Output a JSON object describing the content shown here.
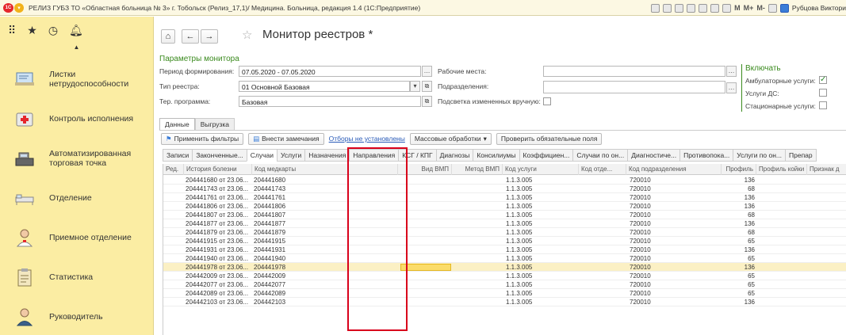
{
  "window": {
    "title": "РЕЛИЗ ГУБЗ ТО «Областная больница № 3» г. Тобольск (Релиз_17,1)/ Медицина. Больница, редакция 1.4  (1С:Предприятие)",
    "logo_text": "1С",
    "toolbar_text": [
      "M",
      "M+",
      "M-"
    ],
    "user": "Рубцова Виктори"
  },
  "sidebar": {
    "items": [
      {
        "label": "Листки нетрудоспособности",
        "icon": "sick-leave-icon"
      },
      {
        "label": "Контроль исполнения",
        "icon": "medical-case-icon"
      },
      {
        "label": "Автоматизированная торговая точка",
        "icon": "cash-register-icon"
      },
      {
        "label": "Отделение",
        "icon": "hospital-bed-icon"
      },
      {
        "label": "Приемное отделение",
        "icon": "doctor-icon"
      },
      {
        "label": "Статистика",
        "icon": "clipboard-icon"
      },
      {
        "label": "Руководитель",
        "icon": "manager-icon"
      }
    ]
  },
  "page": {
    "title": "Монитор реестров *"
  },
  "params": {
    "header": "Параметры монитора",
    "period_label": "Период формирования:",
    "period_value": "07.05.2020 - 07.05.2020",
    "type_label": "Тип реестра:",
    "type_value": "01 Основной Базовая",
    "program_label": "Тер. программа:",
    "program_value": "Базовая",
    "workplaces_label": "Рабочие места:",
    "divisions_label": "Подразделения:",
    "highlight_label": "Подсветка измененных вручную:",
    "include_header": "Включать",
    "outpatient_label": "Амбулаторные услуги:",
    "dayhosp_label": "Услуги ДС:",
    "inpatient_label": "Стационарные услуги:",
    "outpatient_checked": true
  },
  "tabs": [
    "Данные",
    "Выгрузка"
  ],
  "toolbar": {
    "apply_filters": "Применить фильтры",
    "add_notes": "Внести замечания",
    "filters_link": "Отборы не установлены",
    "mass_processing": "Массовые обработки",
    "check_services": "Проверить обязательные поля"
  },
  "subtabs": [
    "Записи",
    "Законченные...",
    "Случаи",
    "Услуги",
    "Назначения",
    "Направления",
    "КСГ / КПГ",
    "Диагнозы",
    "Консилиумы",
    "Коэффициен...",
    "Случаи по он...",
    "Диагностиче...",
    "Противопока...",
    "Услуги по он...",
    "Препар"
  ],
  "table": {
    "headers": [
      "Ред.",
      "История болезни",
      "Код медкарты",
      "Вид ВМП",
      "Метод ВМП",
      "Код услуги",
      "Код отде...",
      "Код подразделения",
      "Профиль",
      "Профиль койки",
      "Признак д"
    ],
    "rows": [
      {
        "history": "204441680 от 23.06...",
        "card": "204441680",
        "service": "1.1.3.005",
        "division": "720010",
        "profile": "136"
      },
      {
        "history": "204441743 от 23.06...",
        "card": "204441743",
        "service": "1.1.3.005",
        "division": "720010",
        "profile": "68"
      },
      {
        "history": "204441761 от 23.06...",
        "card": "204441761",
        "service": "1.1.3.005",
        "division": "720010",
        "profile": "136"
      },
      {
        "history": "204441806 от 23.06...",
        "card": "204441806",
        "service": "1.1.3.005",
        "division": "720010",
        "profile": "136"
      },
      {
        "history": "204441807 от 23.06...",
        "card": "204441807",
        "service": "1.1.3.005",
        "division": "720010",
        "profile": "68"
      },
      {
        "history": "204441877 от 23.06...",
        "card": "204441877",
        "service": "1.1.3.005",
        "division": "720010",
        "profile": "136"
      },
      {
        "history": "204441879 от 23.06...",
        "card": "204441879",
        "service": "1.1.3.005",
        "division": "720010",
        "profile": "68"
      },
      {
        "history": "204441915 от 23.06...",
        "card": "204441915",
        "service": "1.1.3.005",
        "division": "720010",
        "profile": "65"
      },
      {
        "history": "204441931 от 23.06...",
        "card": "204441931",
        "service": "1.1.3.005",
        "division": "720010",
        "profile": "136"
      },
      {
        "history": "204441940 от 23.06...",
        "card": "204441940",
        "service": "1.1.3.005",
        "division": "720010",
        "profile": "65"
      },
      {
        "history": "204441978 от 23.06...",
        "card": "204441978",
        "service": "1.1.3.005",
        "division": "720010",
        "profile": "136"
      },
      {
        "history": "204442009 от 23.06...",
        "card": "204442009",
        "service": "1.1.3.005",
        "division": "720010",
        "profile": "65"
      },
      {
        "history": "204442077 от 23.06...",
        "card": "204442077",
        "service": "1.1.3.005",
        "division": "720010",
        "profile": "65"
      },
      {
        "history": "204442089 от 23.06...",
        "card": "204442089",
        "service": "1.1.3.005",
        "division": "720010",
        "profile": "65"
      },
      {
        "history": "204442103 от 23.06...",
        "card": "204442103",
        "service": "1.1.3.005",
        "division": "720010",
        "profile": "136"
      }
    ],
    "selected_row": 10
  },
  "colors": {
    "sidebar_bg": "#fbeda3",
    "accent_green": "#3a8a1e",
    "highlight_red": "#d9001b",
    "selected_row": "#fbf0c4"
  }
}
